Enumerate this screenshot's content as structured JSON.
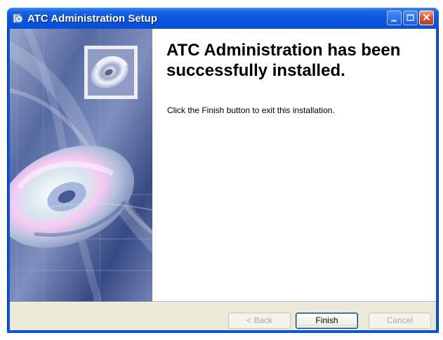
{
  "window": {
    "title": "ATC Administration Setup",
    "icon": "setup-disk-icon",
    "controls": {
      "minimize": "minimize-icon",
      "maximize": "maximize-icon",
      "close": "close-icon",
      "close_glyph": "✕"
    }
  },
  "content": {
    "heading": "ATC Administration has been successfully installed.",
    "message": "Click the Finish button to exit this installation."
  },
  "buttons": {
    "back": "< Back",
    "finish": "Finish",
    "cancel": "Cancel"
  },
  "states": {
    "back_enabled": false,
    "finish_enabled": true,
    "cancel_enabled": false
  },
  "colors": {
    "titlebar": "#0a54d8",
    "dialog_background": "#ece9d8",
    "content_background": "#ffffff",
    "side_banner": "#4c5f99",
    "button_border": "#003c74"
  }
}
